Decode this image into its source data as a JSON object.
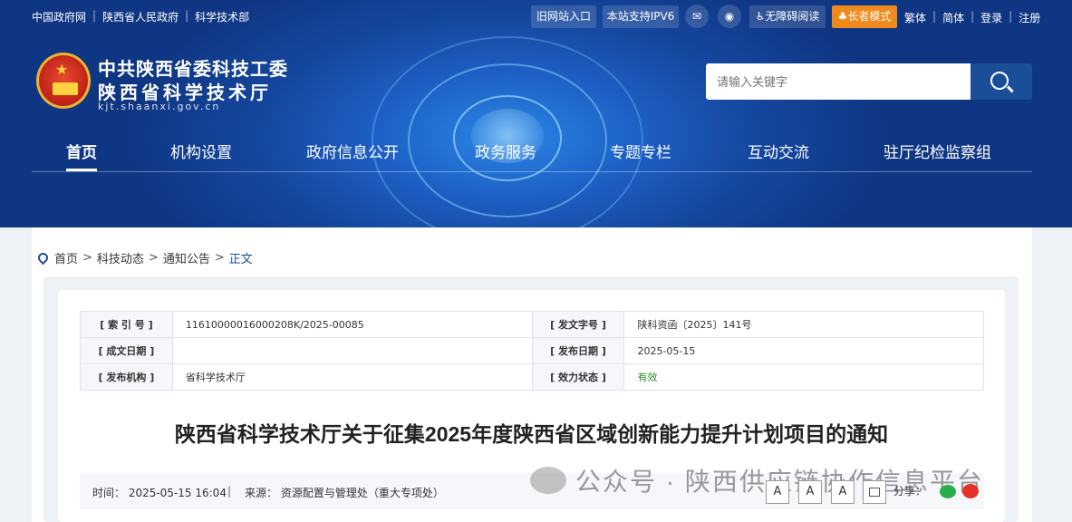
{
  "topbar": {
    "left_links": [
      "中国政府网",
      "陕西省人民政府",
      "科学技术部"
    ],
    "old_site": "旧网站入口",
    "ipv6": "本站支持IPV6",
    "wechat_icon": "wechat-icon",
    "weibo_icon": "weibo-icon",
    "accessible": "无障碍阅读",
    "elder": "长者模式",
    "right_links": [
      "繁体",
      "简体",
      "登录",
      "注册"
    ]
  },
  "brand": {
    "name_line1": "中共陕西省委科技工委",
    "name_line2": "陕西省科学技术厅",
    "url": "kjt.shaanxi.gov.cn"
  },
  "search": {
    "placeholder": "请输入关键字"
  },
  "nav": {
    "items": [
      "首页",
      "机构设置",
      "政府信息公开",
      "政务服务",
      "专题专栏",
      "互动交流",
      "驻厅纪检监察组"
    ],
    "active_index": 0
  },
  "breadcrumb": [
    "首页",
    "科技动态",
    "通知公告",
    "正文"
  ],
  "meta": {
    "rows": [
      {
        "k1": "[ 索 引 号 ]",
        "v1": "11610000016000208K/2025-00085",
        "k2": "[ 发文字号 ]",
        "v2": "陕科资函〔2025〕141号"
      },
      {
        "k1": "[ 成文日期 ]",
        "v1": "",
        "k2": "[ 发布日期 ]",
        "v2": "2025-05-15"
      },
      {
        "k1": "[ 发布机构 ]",
        "v1": "省科学技术厅",
        "k2": "[ 效力状态 ]",
        "v2": "有效"
      }
    ]
  },
  "article": {
    "title": "陕西省科学技术厅关于征集2025年度陕西省区域创新能力提升计划项目的通知",
    "time": "时间： 2025-05-15 16:04",
    "separator": "|",
    "source": "来源： 资源配置与管理处（重大专项处）"
  },
  "tools": {
    "font_buttons": [
      "A",
      "A",
      "A"
    ],
    "share_label": "分享："
  },
  "watermark": {
    "text": "公众号 · 陕西供应链协作信息平台"
  },
  "colors": {
    "brand_blue": "#1a4e97",
    "elder_orange": "#f08a1c",
    "valid_green": "#2a8a2a"
  }
}
